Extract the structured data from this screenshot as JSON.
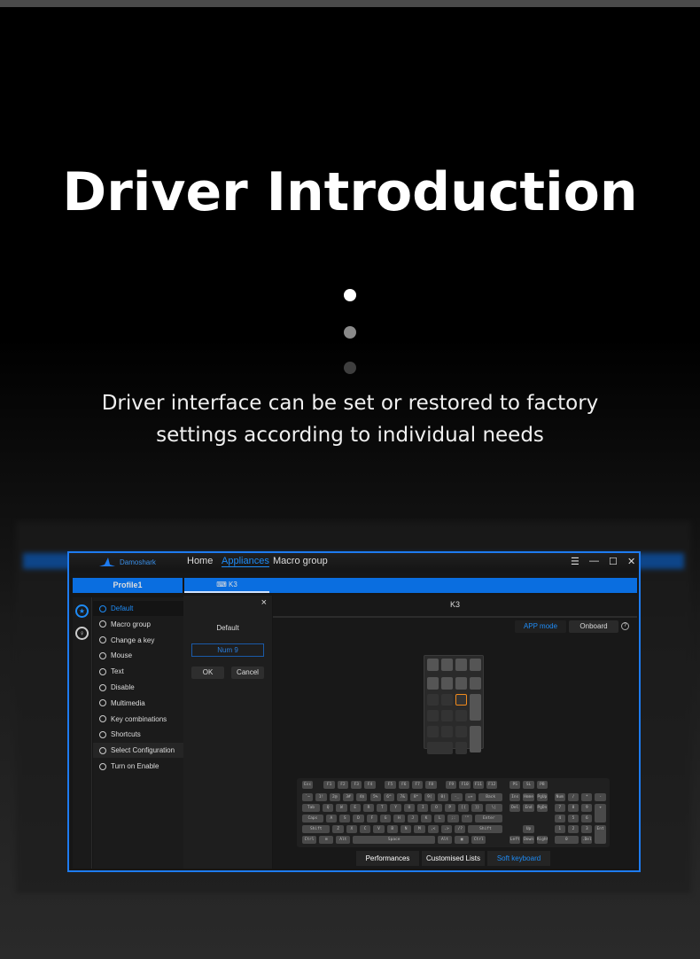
{
  "page": {
    "title": "Driver Introduction",
    "subtitle_line1": "Driver interface can be set or restored to factory",
    "subtitle_line2": "settings according to individual needs",
    "dots": [
      "#ffffff",
      "#8a8a8a",
      "#3e3e3e"
    ]
  },
  "colors": {
    "accent": "#1e7bf0",
    "highlight": "#f08a1c"
  },
  "app": {
    "logo": "Damoshark",
    "nav": [
      {
        "label": "Home",
        "active": false
      },
      {
        "label": "Appliances",
        "active": true
      },
      {
        "label": "Macro group",
        "active": false
      }
    ],
    "window_controls": {
      "menu": "☰",
      "minimize": "—",
      "maximize": "☐",
      "close": "✕"
    },
    "profile": "Profile1",
    "device_tab": "K3",
    "device_icon": "keyboard-icon",
    "menu": [
      "Default",
      "Macro group",
      "Change a key",
      "Mouse",
      "Text",
      "Disable",
      "Multimedia",
      "Key combinations",
      "Shortcuts",
      "Select Configuration",
      "Turn on Enable"
    ],
    "dialog": {
      "title": "Default",
      "value": "Num 9",
      "ok": "OK",
      "cancel": "Cancel",
      "close": "×"
    },
    "panel": {
      "title": "K3",
      "app_mode": "APP mode",
      "onboard": "Onboard",
      "help": "?"
    },
    "bottom_tabs": [
      {
        "label": "Performances",
        "active": false
      },
      {
        "label": "Customised Lists",
        "active": false
      },
      {
        "label": "Soft keyboard",
        "active": true
      }
    ],
    "keyboard_rows": [
      [
        "Esc",
        "F1",
        "F2",
        "F3",
        "F4",
        "F5",
        "F6",
        "F7",
        "F8",
        "F9",
        "F10",
        "F11",
        "F12",
        "PS",
        "SL",
        "PB"
      ],
      [
        "`~",
        "1!",
        "2@",
        "3#",
        "4$",
        "5%",
        "6^",
        "7&",
        "8*",
        "9(",
        "0)",
        "-_",
        "=+",
        "Back",
        "Ins",
        "Home",
        "PgUp",
        "Num",
        "/",
        "*",
        "-"
      ],
      [
        "Tab",
        "Q",
        "W",
        "E",
        "R",
        "T",
        "Y",
        "U",
        "I",
        "O",
        "P",
        "[{",
        "]}",
        "\\|",
        "Del",
        "End",
        "PgDn",
        "7",
        "8",
        "9",
        "+"
      ],
      [
        "Caps",
        "A",
        "S",
        "D",
        "F",
        "G",
        "H",
        "J",
        "K",
        "L",
        ";:",
        "'\"",
        "Enter",
        "4",
        "5",
        "6"
      ],
      [
        "Shift",
        "Z",
        "X",
        "C",
        "V",
        "B",
        "N",
        "M",
        ",<",
        ".>",
        "/?",
        "Shift",
        "Up",
        "1",
        "2",
        "3",
        "Ent"
      ],
      [
        "Ctrl",
        "⊞",
        "Alt",
        "Space",
        "Alt",
        "▣",
        "Ctrl",
        "Left",
        "Down",
        "Right",
        "0",
        ".Del"
      ]
    ]
  }
}
